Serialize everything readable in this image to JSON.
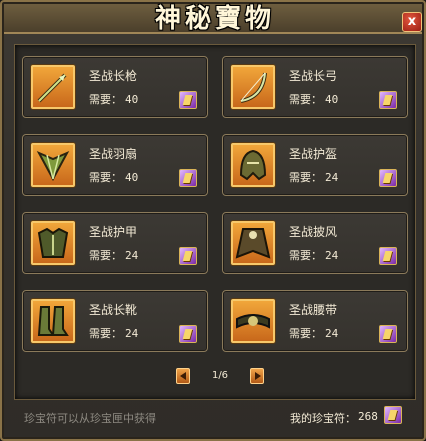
{
  "window": {
    "title": "神秘寶物",
    "close_label": "x"
  },
  "items": [
    {
      "name": "圣战长枪",
      "req_label": "需要：",
      "cost": "40",
      "icon": "spear-icon"
    },
    {
      "name": "圣战长弓",
      "req_label": "需要：",
      "cost": "40",
      "icon": "bow-icon"
    },
    {
      "name": "圣战羽扇",
      "req_label": "需要：",
      "cost": "40",
      "icon": "feather-fan-icon"
    },
    {
      "name": "圣战护盔",
      "req_label": "需要：",
      "cost": "24",
      "icon": "helmet-icon"
    },
    {
      "name": "圣战护甲",
      "req_label": "需要：",
      "cost": "24",
      "icon": "armor-icon"
    },
    {
      "name": "圣战披风",
      "req_label": "需要：",
      "cost": "24",
      "icon": "cloak-icon"
    },
    {
      "name": "圣战长靴",
      "req_label": "需要：",
      "cost": "24",
      "icon": "boots-icon"
    },
    {
      "name": "圣战腰带",
      "req_label": "需要：",
      "cost": "24",
      "icon": "belt-icon"
    }
  ],
  "pager": {
    "current": "1/6"
  },
  "footer": {
    "hint": "珍宝符可以从珍宝匣中获得",
    "balance_label": "我的珍宝符：",
    "balance": "268"
  },
  "colors": {
    "slot_bg": "#e08a2c",
    "token": "#9b3cc9",
    "text": "#f3ead5"
  }
}
